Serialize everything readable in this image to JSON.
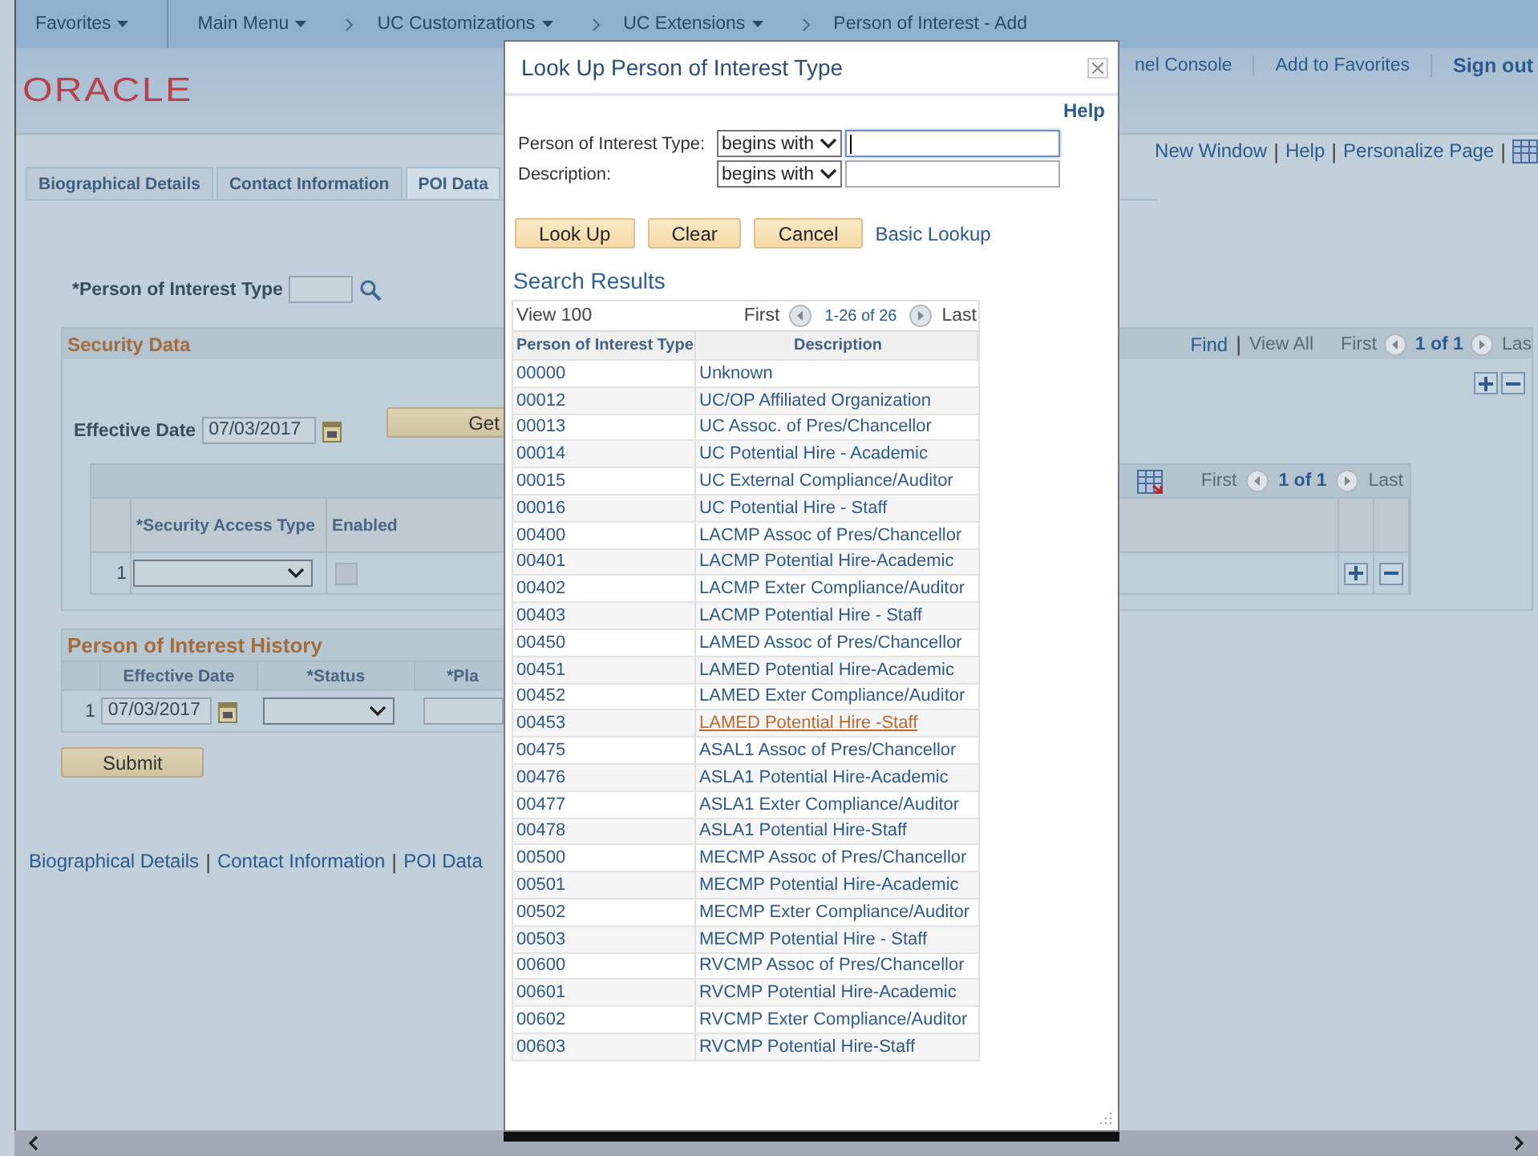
{
  "nav_bar": {
    "items": [
      {
        "label": "Favorites",
        "dropdown": true,
        "breadcrumb": false
      },
      {
        "label": "Main Menu",
        "dropdown": true,
        "breadcrumb": false
      },
      {
        "label": "UC Customizations",
        "dropdown": true,
        "breadcrumb": true
      },
      {
        "label": "UC Extensions",
        "dropdown": true,
        "breadcrumb": true
      },
      {
        "label": "Person of Interest - Add",
        "dropdown": false,
        "breadcrumb": true
      }
    ]
  },
  "header": {
    "logo": "ORACLE",
    "links": [
      {
        "label": "nel Console",
        "emphasis": false
      },
      {
        "label": "Add to Favorites",
        "emphasis": false
      },
      {
        "label": "Sign out",
        "emphasis": true
      }
    ]
  },
  "page_links": {
    "items": [
      "New Window",
      "Help",
      "Personalize Page"
    ],
    "separator": "|"
  },
  "tabs": [
    {
      "label": "Biographical Details",
      "selected": false
    },
    {
      "label": "Contact Information",
      "selected": false
    },
    {
      "label": "POI Data",
      "selected": true
    }
  ],
  "person_type_field": {
    "label": "*Person of Interest Type"
  },
  "security_data": {
    "title": "Security Data",
    "find": "Find",
    "separator": "|",
    "view_all": "View All",
    "first": "First",
    "count": "1 of 1",
    "last": "Las",
    "effective_date": {
      "label": "Effective Date",
      "value": "07/03/2017"
    },
    "get_button": "Get",
    "grid": {
      "first": "First",
      "count": "1 of 1",
      "last": "Last",
      "columns": [
        "*Security Access Type",
        "Enabled"
      ],
      "rows": [
        {
          "number": "1",
          "enabled": false
        }
      ]
    }
  },
  "history": {
    "title": "Person of Interest History",
    "columns": [
      "Effective Date",
      "*Status",
      "*Pla"
    ],
    "rows": [
      {
        "number": "1",
        "date": "07/03/2017"
      }
    ]
  },
  "submit": "Submit",
  "footer_links": {
    "items": [
      "Biographical Details",
      "Contact Information",
      "POI Data"
    ],
    "separator": "|"
  },
  "dialog": {
    "title": "Look Up Person of Interest Type",
    "help": "Help",
    "criteria": [
      {
        "label": "Person of Interest Type:",
        "operator": "begins with",
        "focused": true
      },
      {
        "label": "Description:",
        "operator": "begins with",
        "focused": false
      }
    ],
    "buttons": [
      "Look Up",
      "Clear",
      "Cancel"
    ],
    "basic_lookup": "Basic Lookup",
    "results_title": "Search Results",
    "view": "View 100",
    "first": "First",
    "range": "1-26 of 26",
    "last": "Last",
    "columns": [
      "Person of Interest Type",
      "Description"
    ],
    "rows": [
      {
        "code": "00000",
        "description": "Unknown",
        "hovered": false
      },
      {
        "code": "00012",
        "description": "UC/OP Affiliated Organization",
        "hovered": false
      },
      {
        "code": "00013",
        "description": "UC Assoc. of Pres/Chancellor",
        "hovered": false
      },
      {
        "code": "00014",
        "description": "UC Potential Hire - Academic",
        "hovered": false
      },
      {
        "code": "00015",
        "description": "UC External Compliance/Auditor",
        "hovered": false
      },
      {
        "code": "00016",
        "description": "UC Potential Hire - Staff",
        "hovered": false
      },
      {
        "code": "00400",
        "description": "LACMP Assoc of Pres/Chancellor",
        "hovered": false
      },
      {
        "code": "00401",
        "description": "LACMP Potential Hire-Academic",
        "hovered": false
      },
      {
        "code": "00402",
        "description": "LACMP Exter Compliance/Auditor",
        "hovered": false
      },
      {
        "code": "00403",
        "description": "LACMP Potential Hire - Staff",
        "hovered": false
      },
      {
        "code": "00450",
        "description": "LAMED Assoc of Pres/Chancellor",
        "hovered": false
      },
      {
        "code": "00451",
        "description": "LAMED Potential Hire-Academic",
        "hovered": false
      },
      {
        "code": "00452",
        "description": "LAMED Exter Compliance/Auditor",
        "hovered": false
      },
      {
        "code": "00453",
        "description": "LAMED Potential Hire -Staff",
        "hovered": true
      },
      {
        "code": "00475",
        "description": "ASAL1 Assoc of Pres/Chancellor",
        "hovered": false
      },
      {
        "code": "00476",
        "description": "ASLA1 Potential Hire-Academic",
        "hovered": false
      },
      {
        "code": "00477",
        "description": "ASLA1 Exter Compliance/Auditor",
        "hovered": false
      },
      {
        "code": "00478",
        "description": "ASLA1 Potential Hire-Staff",
        "hovered": false
      },
      {
        "code": "00500",
        "description": "MECMP Assoc of Pres/Chancellor",
        "hovered": false
      },
      {
        "code": "00501",
        "description": "MECMP Potential Hire-Academic",
        "hovered": false
      },
      {
        "code": "00502",
        "description": "MECMP Exter Compliance/Auditor",
        "hovered": false
      },
      {
        "code": "00503",
        "description": "MECMP Potential Hire - Staff",
        "hovered": false
      },
      {
        "code": "00600",
        "description": "RVCMP Assoc of Pres/Chancellor",
        "hovered": false
      },
      {
        "code": "00601",
        "description": "RVCMP Potential Hire-Academic",
        "hovered": false
      },
      {
        "code": "00602",
        "description": "RVCMP Exter Compliance/Auditor",
        "hovered": false
      },
      {
        "code": "00603",
        "description": "RVCMP Potential Hire-Staff",
        "hovered": false
      }
    ]
  }
}
